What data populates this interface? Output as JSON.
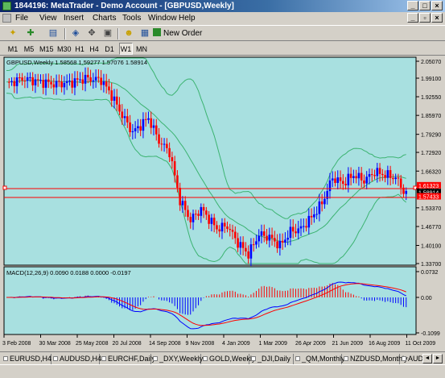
{
  "window": {
    "title": "1844196: MetaTrader - Demo Account - [GBPUSD,Weekly]",
    "controls": {
      "minimize": "_",
      "maximize": "□",
      "close": "×"
    }
  },
  "menu": {
    "items": [
      {
        "label": "File"
      },
      {
        "label": "View"
      },
      {
        "label": "Insert"
      },
      {
        "label": "Charts"
      },
      {
        "label": "Tools"
      },
      {
        "label": "Window"
      },
      {
        "label": "Help"
      }
    ],
    "controls": {
      "minimize": "_",
      "restore": "▫",
      "close": "×"
    }
  },
  "toolbar": {
    "new_order_label": "New Order"
  },
  "timeframes": [
    {
      "label": "M1"
    },
    {
      "label": "M5"
    },
    {
      "label": "M15"
    },
    {
      "label": "M30"
    },
    {
      "label": "H1"
    },
    {
      "label": "H4"
    },
    {
      "label": "D1"
    },
    {
      "label": "W1",
      "active": true
    },
    {
      "label": "MN"
    }
  ],
  "chart": {
    "header": "GBPUSD,Weekly  1.58568 1.59277 1.57076 1.58914",
    "price_axis": [
      "2.05070",
      "1.99100",
      "1.92550",
      "1.85970",
      "1.79290",
      "1.72920",
      "1.66320",
      "1.60140",
      "1.53370",
      "1.46770",
      "1.40100",
      "1.33700"
    ],
    "price_labels": [
      {
        "value": "1.61323",
        "color": "#ff0000"
      },
      {
        "value": "1.58914",
        "color": "#000000"
      },
      {
        "value": "1.57433",
        "color": "#ff0000"
      }
    ],
    "macd_header": "MACD(12,26,9) 0.0090 0.0188 0.0000 -0.0197",
    "macd_axis": [
      "0.0732",
      "0.00",
      "-0.1099"
    ],
    "date_axis": [
      "3 Feb 2008",
      "30 Mar 2008",
      "25 May 2008",
      "20 Jul 2008",
      "14 Sep 2008",
      "9 Nov 2008",
      "4 Jan 2009",
      "1 Mar 2009",
      "26 Apr 2009",
      "21 Jun 2009",
      "16 Aug 2009",
      "11 Oct 2009"
    ],
    "colors": {
      "background": "#a8e0e0",
      "bull": "#0000ff",
      "bear": "#ff0000",
      "band": "#3cb371",
      "macd": "#0000ff",
      "signal": "#ff0000",
      "line": "#ff0000"
    }
  },
  "tabs": [
    {
      "label": "EURUSD,H4"
    },
    {
      "label": "AUDUSD,H4"
    },
    {
      "label": "EURCHF,Daily"
    },
    {
      "label": "_DXY,Weekly"
    },
    {
      "label": "GOLD,Weekly"
    },
    {
      "label": "_DJI,Daily"
    },
    {
      "label": "_QM,Monthly"
    },
    {
      "label": "NZDUSD,Monthly"
    },
    {
      "label": "AUDNZ"
    }
  ],
  "tab_arrows": {
    "left": "◄",
    "right": "►"
  }
}
